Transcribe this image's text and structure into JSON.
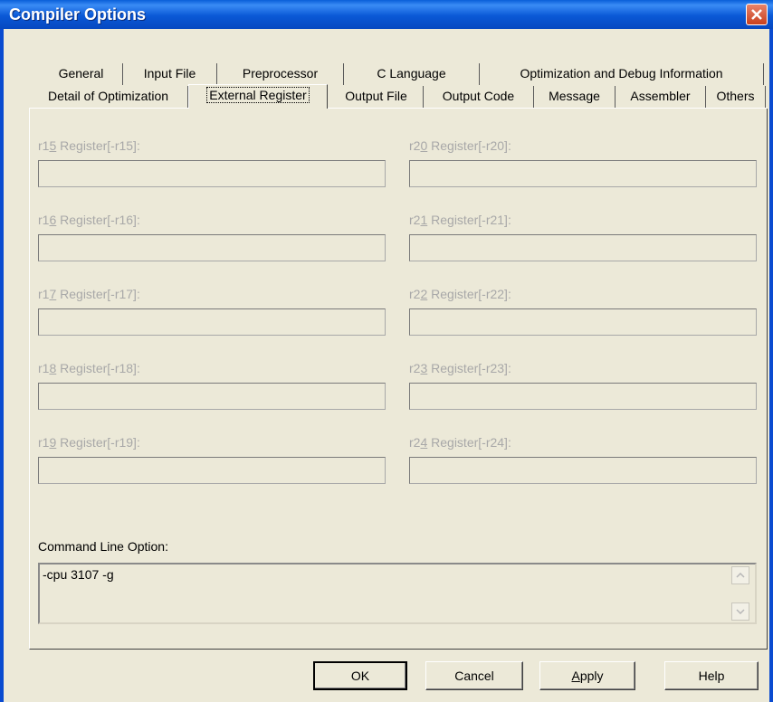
{
  "window": {
    "title": "Compiler Options"
  },
  "tabs_row1": [
    "General",
    "Input File",
    "Preprocessor",
    "C Language",
    "Optimization and Debug Information"
  ],
  "tabs_row2": [
    "Detail of Optimization",
    "External Register",
    "Output File",
    "Output Code",
    "Message",
    "Assembler",
    "Others"
  ],
  "active_tab": "External Register",
  "registers_left": [
    {
      "prefix": "r1",
      "mnemonic": "5",
      "suffix": " Register[-r15]:",
      "value": ""
    },
    {
      "prefix": "r1",
      "mnemonic": "6",
      "suffix": " Register[-r16]:",
      "value": ""
    },
    {
      "prefix": "r1",
      "mnemonic": "7",
      "suffix": " Register[-r17]:",
      "value": ""
    },
    {
      "prefix": "r1",
      "mnemonic": "8",
      "suffix": " Register[-r18]:",
      "value": ""
    },
    {
      "prefix": "r1",
      "mnemonic": "9",
      "suffix": " Register[-r19]:",
      "value": ""
    }
  ],
  "registers_right": [
    {
      "prefix": "r2",
      "mnemonic": "0",
      "suffix": " Register[-r20]:",
      "value": ""
    },
    {
      "prefix": "r2",
      "mnemonic": "1",
      "suffix": " Register[-r21]:",
      "value": ""
    },
    {
      "prefix": "r2",
      "mnemonic": "2",
      "suffix": " Register[-r22]:",
      "value": ""
    },
    {
      "prefix": "r2",
      "mnemonic": "3",
      "suffix": " Register[-r23]:",
      "value": ""
    },
    {
      "prefix": "r2",
      "mnemonic": "4",
      "suffix": " Register[-r24]:",
      "value": ""
    }
  ],
  "command_line": {
    "label": "Command Line Option:",
    "value": "-cpu 3107 -g"
  },
  "buttons": {
    "ok": "OK",
    "cancel": "Cancel",
    "apply_prefix": "",
    "apply_mnemonic": "A",
    "apply_rest": "pply",
    "help": "Help"
  },
  "colors": {
    "title_bar": "#0a58d6",
    "dialog_bg": "#ece9d8",
    "disabled_text": "#a8a8a8",
    "close": "#c8401e"
  }
}
